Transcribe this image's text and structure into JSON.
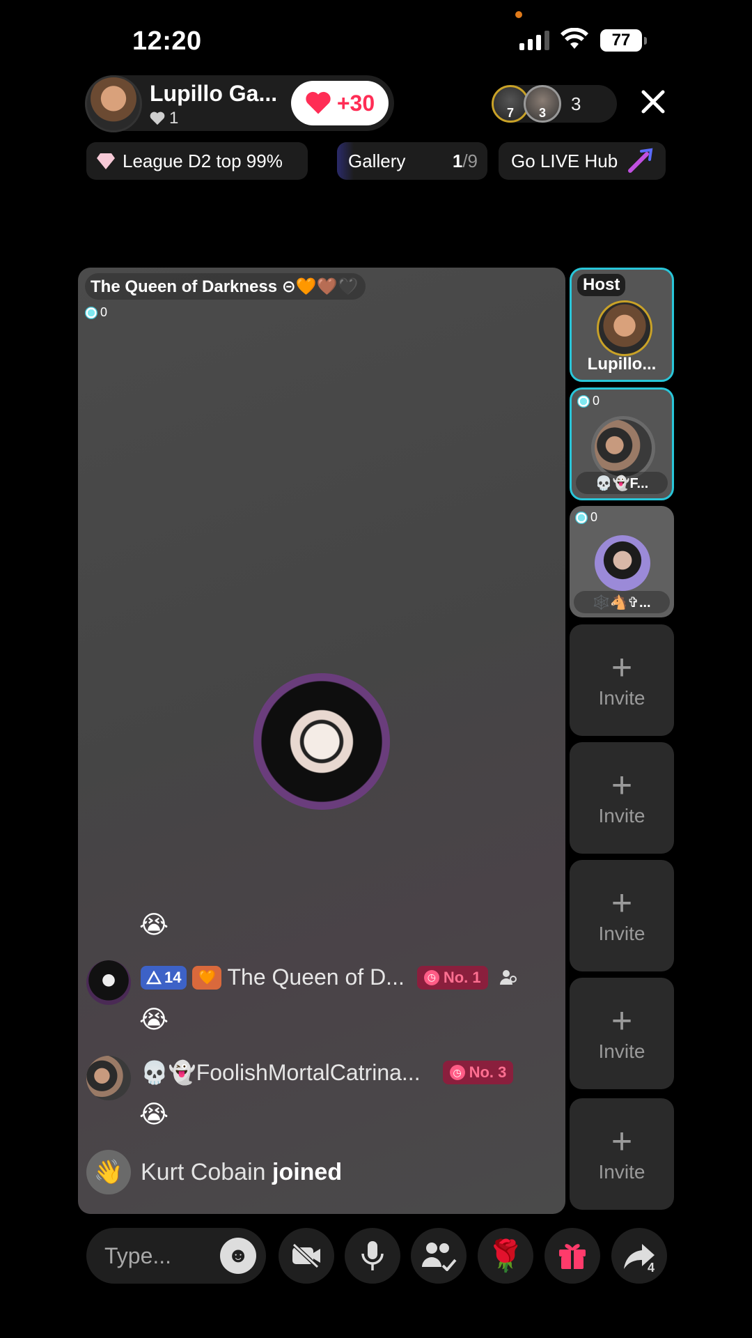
{
  "status": {
    "time": "12:20",
    "battery": "77"
  },
  "header": {
    "host_name": "Lupillo Ga...",
    "host_likes": "1",
    "plus_label": "+30",
    "viewer_badges": [
      "7",
      "3"
    ],
    "viewer_count": "3"
  },
  "chips": {
    "league": "League D2 top 99%",
    "gallery_label": "Gallery",
    "gallery_current": "1",
    "gallery_total": "/9",
    "golive": "Go LIVE Hub"
  },
  "stage": {
    "title": "The Queen of Darkness ⊝🧡🤎🖤",
    "score": "0"
  },
  "chat": [
    {
      "type": "emoji",
      "text": "😭"
    },
    {
      "type": "message",
      "level": "14",
      "name": "The Queen of D...",
      "rank": "No. 1"
    },
    {
      "type": "emoji",
      "text": "😭"
    },
    {
      "type": "message",
      "name": "💀👻FoolishMortalCatrina...",
      "rank": "No. 3"
    },
    {
      "type": "emoji",
      "text": "😭"
    }
  ],
  "join": {
    "user": "Kurt Cobain",
    "action": "joined"
  },
  "side": {
    "host_label": "Host",
    "host_name": "Lupillo...",
    "guest1_score": "0",
    "guest1_tag": "💀👻F...",
    "guest2_score": "0",
    "guest2_tag": "🕸️🐴✞...",
    "invite_label": "Invite"
  },
  "bottom": {
    "type_placeholder": "Type...",
    "share_count": "4"
  },
  "colors": {
    "accent_cyan": "#29c6d9",
    "like_red": "#ff2d55",
    "rank_pink": "#ff6f91",
    "level_blue": "#3d62c7"
  },
  "icons": [
    "signal-icon",
    "wifi-icon",
    "battery-icon",
    "heart-icon",
    "close-icon",
    "diamond-icon",
    "sword-icon",
    "gem-icon",
    "wave-icon",
    "emoji-icon",
    "camera-off-icon",
    "mic-icon",
    "people-icon",
    "rose-icon",
    "gift-icon",
    "share-icon"
  ]
}
